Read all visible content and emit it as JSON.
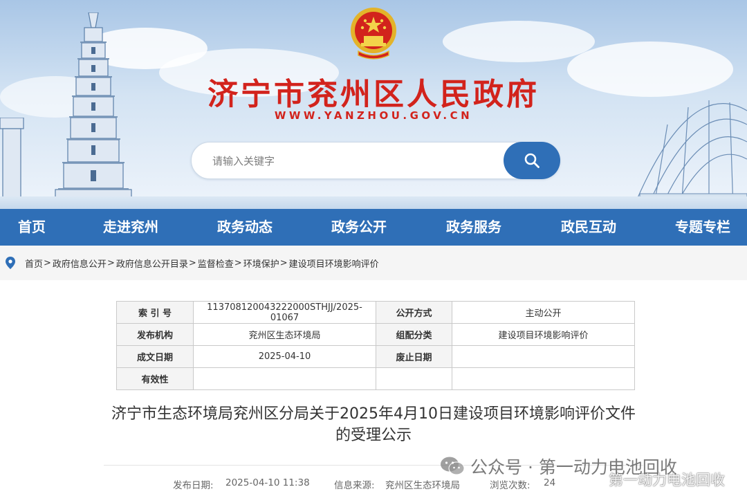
{
  "header": {
    "site_title": "济宁市兖州区人民政府",
    "site_url": "WWW.YANZHOU.GOV.CN",
    "search_placeholder": "请输入关键字"
  },
  "nav": {
    "items": [
      "首页",
      "走进兖州",
      "政务动态",
      "政务公开",
      "政务服务",
      "政民互动",
      "专题专栏"
    ]
  },
  "breadcrumb": {
    "items": [
      "首页",
      "政府信息公开",
      "政府信息公开目录",
      "监督检查",
      "环境保护",
      "建设项目环境影响评价"
    ],
    "separator": ">"
  },
  "info_table": {
    "rows": [
      [
        "索 引 号",
        "113708120043222000STHJJ/2025-01067",
        "公开方式",
        "主动公开"
      ],
      [
        "发布机构",
        "兖州区生态环境局",
        "组配分类",
        "建设项目环境影响评价"
      ],
      [
        "成文日期",
        "2025-04-10",
        "废止日期",
        ""
      ],
      [
        "有效性",
        "",
        "",
        ""
      ]
    ]
  },
  "article": {
    "title_line1": "济宁市生态环境局兖州区分局关于2025年4月10日建设项目环境影响评价文件",
    "title_line2": "的受理公示",
    "publish_label": "发布日期:",
    "publish_date": "2025-04-10 11:38",
    "source_label": "信息来源:",
    "source": "兖州区生态环境局",
    "views_label": "浏览次数:",
    "views": "24"
  },
  "watermark": {
    "text": "公众号 · 第一动力电池回收",
    "corner": "第一动力电池回收"
  },
  "colors": {
    "brand_red": "#d2231c",
    "nav_blue": "#2f6fb7"
  },
  "icons": [
    "national-emblem-icon",
    "search-icon",
    "location-pin-icon",
    "wechat-icon"
  ]
}
